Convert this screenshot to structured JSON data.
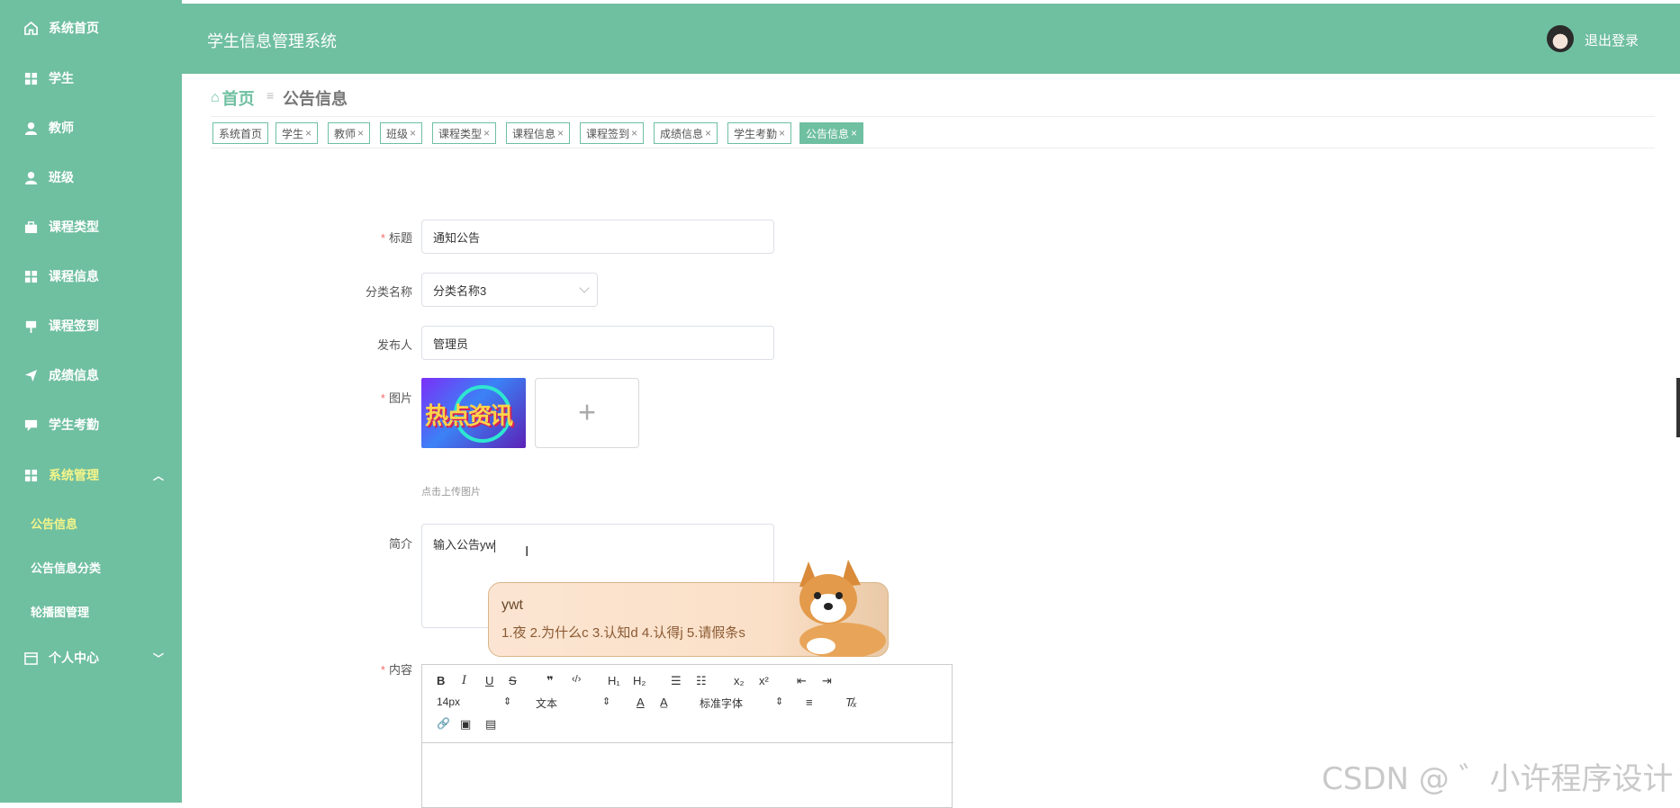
{
  "app": {
    "title": "学生信息管理系统",
    "logout": "退出登录"
  },
  "sidebar": {
    "items": [
      {
        "label": "系统首页",
        "icon": "home-icon"
      },
      {
        "label": "学生",
        "icon": "grid-icon"
      },
      {
        "label": "教师",
        "icon": "user-icon"
      },
      {
        "label": "班级",
        "icon": "user-icon"
      },
      {
        "label": "课程类型",
        "icon": "briefcase-icon"
      },
      {
        "label": "课程信息",
        "icon": "grid-icon"
      },
      {
        "label": "课程签到",
        "icon": "signpost-icon"
      },
      {
        "label": "成绩信息",
        "icon": "send-icon"
      },
      {
        "label": "学生考勤",
        "icon": "comment-icon"
      },
      {
        "label": "系统管理",
        "icon": "grid-icon"
      }
    ],
    "subitems": [
      "公告信息",
      "公告信息分类",
      "轮播图管理"
    ],
    "personal": "个人中心"
  },
  "breadcrumb": {
    "home": "首页",
    "sep": "≡",
    "current": "公告信息"
  },
  "tabs": [
    "系统首页",
    "学生",
    "教师",
    "班级",
    "课程类型",
    "课程信息",
    "课程签到",
    "成绩信息",
    "学生考勤",
    "公告信息"
  ],
  "tab_close": "×",
  "form": {
    "title_label": "标题",
    "title_value": "通知公告",
    "category_label": "分类名称",
    "category_value": "分类名称3",
    "publisher_label": "发布人",
    "publisher_value": "管理员",
    "image_label": "图片",
    "image_text": "热点资讯",
    "upload_hint": "点击上传图片",
    "intro_label": "简介",
    "intro_value": "输入公告yw",
    "content_label": "内容",
    "required_mark": "*"
  },
  "ime": {
    "input": "ywt",
    "candidates": "1.夜  2.为什么c  3.认知d  4.认得j  5.请假条s"
  },
  "editor": {
    "row1": [
      "B",
      "I",
      "U",
      "S",
      "❞",
      "‹/›",
      "H₁",
      "H₂",
      "☰",
      "☷",
      "x₂",
      "x²",
      "⇤",
      "⇥"
    ],
    "font_size": "14px",
    "block": "文本",
    "font_family": "标准字体",
    "row2_icons": [
      "A",
      "A̲",
      "≡",
      "T̸ₓ"
    ],
    "row3": [
      "🔗",
      "▣",
      "▤"
    ]
  },
  "watermark": "CSDN @ ゛小许程序设计"
}
